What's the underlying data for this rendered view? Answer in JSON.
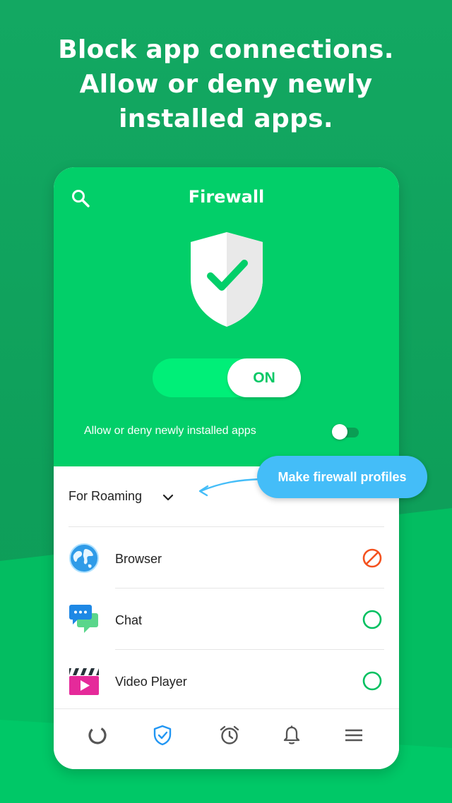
{
  "headline": {
    "line1": "Block app connections.",
    "line2": "Allow or deny newly",
    "line3": "installed apps."
  },
  "header": {
    "title": "Firewall",
    "search_icon": "search-icon"
  },
  "main_switch": {
    "label": "ON",
    "state": "on"
  },
  "new_apps": {
    "label": "Allow or deny newly installed apps",
    "enabled": false
  },
  "profile": {
    "selected": "For Roaming",
    "icon": "chevron-down-icon"
  },
  "apps": [
    {
      "label": "Browser",
      "icon": "globe-icon",
      "status": "blocked",
      "status_icon": "blocked-icon"
    },
    {
      "label": "Chat",
      "icon": "chat-icon",
      "status": "allowed",
      "status_icon": "allowed-circle-icon"
    },
    {
      "label": "Video Player",
      "icon": "clapperboard-icon",
      "status": "allowed",
      "status_icon": "allowed-circle-icon"
    }
  ],
  "bottom_nav": [
    {
      "icon": "dashboard-ring-icon",
      "active": false
    },
    {
      "icon": "shield-check-icon",
      "active": true
    },
    {
      "icon": "alarm-clock-icon",
      "active": false
    },
    {
      "icon": "bell-icon",
      "active": false
    },
    {
      "icon": "menu-icon",
      "active": false
    }
  ],
  "tooltip": {
    "text": "Make firewall profiles"
  },
  "colors": {
    "background": "#0fa35c",
    "header_green": "#02cf69",
    "switch_green": "#00ef78",
    "blocked": "#f4511e",
    "allowed": "#00c060",
    "tooltip_blue": "#44bdf8",
    "nav_active": "#2196f3"
  }
}
